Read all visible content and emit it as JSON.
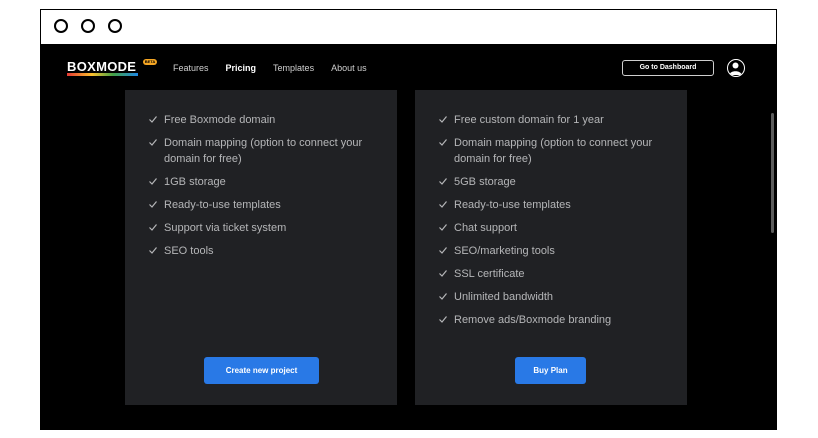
{
  "nav": {
    "logo": "BOXMODE",
    "beta": "BETA",
    "links": [
      "Features",
      "Pricing",
      "Templates",
      "About us"
    ],
    "dashboard_label": "Go to Dashboard"
  },
  "plans": [
    {
      "features": [
        "Free Boxmode domain",
        "Domain mapping (option to connect your domain for free)",
        "1GB storage",
        "Ready-to-use templates",
        "Support via ticket system",
        "SEO tools"
      ],
      "cta": "Create new project"
    },
    {
      "features": [
        "Free custom domain for 1 year",
        "Domain mapping (option to connect your domain for free)",
        "5GB storage",
        "Ready-to-use templates",
        "Chat support",
        "SEO/marketing tools",
        "SSL certificate",
        "Unlimited bandwidth",
        "Remove ads/Boxmode branding"
      ],
      "cta": "Buy Plan"
    }
  ],
  "colors": {
    "accent": "#2979e6",
    "card_bg": "#202124",
    "page_bg": "#000000"
  }
}
